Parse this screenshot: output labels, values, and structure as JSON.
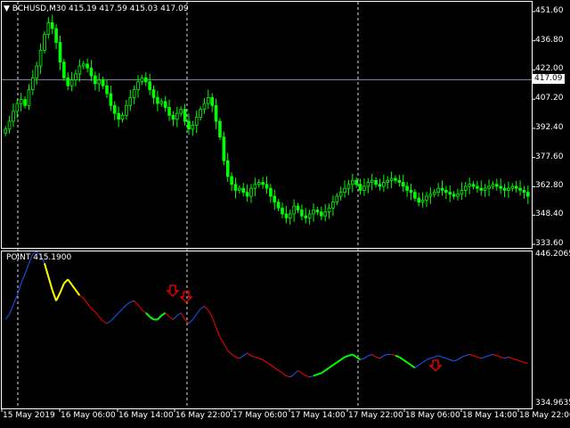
{
  "header": {
    "symbol_line": "BCHUSD,M30  415.19 417.59 415.03 417.09",
    "indicator_line": "POINT 415.1900"
  },
  "price_axis": {
    "labels": [
      "451.60",
      "436.80",
      "422.00",
      "407.20",
      "392.40",
      "377.60",
      "362.80",
      "348.40",
      "333.60"
    ],
    "current_price": "417.09"
  },
  "indicator_axis": {
    "top": "446.2065",
    "bottom": "334.9635"
  },
  "time_axis": {
    "labels": [
      "15 May 2019",
      "16 May 06:00",
      "16 May 14:00",
      "16 May 22:00",
      "17 May 06:00",
      "17 May 14:00",
      "17 May 22:00",
      "18 May 06:00",
      "18 May 14:00",
      "18 May 22:00"
    ]
  },
  "colors": {
    "background": "#000000",
    "candle": "#00ff00",
    "grid": "#ffffff",
    "signal_arrow": "#ff0000",
    "indicator_down": "#ff0000",
    "indicator_up": "#2255ff",
    "indicator_accent": "#ffff00",
    "indicator_green": "#00ff00"
  },
  "chart_data": [
    {
      "type": "candlestick",
      "title": "BCHUSD,M30",
      "ylim": [
        333.6,
        451.6
      ],
      "yticks": [
        451.6,
        436.8,
        422.0,
        407.2,
        392.4,
        377.6,
        362.8,
        348.4,
        333.6
      ],
      "current_price": 417.09,
      "x_ticks": [
        "15 May 2019",
        "16 May 06:00",
        "16 May 14:00",
        "16 May 22:00",
        "17 May 06:00",
        "17 May 14:00",
        "17 May 22:00",
        "18 May 06:00",
        "18 May 14:00",
        "18 May 22:00"
      ],
      "close": [
        392,
        396,
        401,
        405,
        407,
        404,
        412,
        418,
        424,
        432,
        440,
        446,
        443,
        436,
        426,
        418,
        414,
        417,
        420,
        424,
        425,
        423,
        419,
        415,
        417,
        414,
        410,
        404,
        400,
        397,
        399,
        404,
        408,
        412,
        416,
        418,
        416,
        412,
        408,
        405,
        406,
        403,
        399,
        397,
        400,
        402,
        396,
        392,
        394,
        398,
        402,
        405,
        408,
        404,
        396,
        388,
        376,
        368,
        364,
        361,
        362,
        360,
        358,
        362,
        364,
        365,
        364,
        362,
        358,
        355,
        352,
        349,
        347,
        349,
        353,
        351,
        348,
        347,
        349,
        351,
        350,
        348,
        350,
        352,
        355,
        358,
        360,
        362,
        364,
        366,
        364,
        361,
        363,
        365,
        366,
        364,
        363,
        365,
        366,
        367,
        366,
        365,
        363,
        361,
        360,
        357,
        355,
        356,
        358,
        359,
        360,
        362,
        361,
        360,
        359,
        358,
        359,
        361,
        363,
        364,
        363,
        362,
        361,
        362,
        363,
        364,
        363,
        362,
        361,
        362,
        363,
        362,
        361,
        360,
        358
      ]
    },
    {
      "type": "line",
      "title": "POINT",
      "ylim": [
        334.9635,
        446.2065
      ],
      "last_value": 415.19,
      "series": [
        {
          "values": [
            398,
            402,
            409,
            416,
            425,
            432,
            440,
            447,
            449,
            446,
            440,
            430,
            420,
            412,
            418,
            425,
            428,
            424,
            420,
            416,
            414,
            410,
            406,
            404,
            400,
            397,
            395,
            397,
            400,
            403,
            406,
            409,
            411,
            412,
            409,
            405,
            403,
            400,
            398,
            398,
            401,
            403,
            400,
            398,
            401,
            403,
            398,
            395,
            398,
            402,
            406,
            408,
            405,
            400,
            392,
            385,
            380,
            375,
            372,
            370,
            369,
            371,
            373,
            371,
            370,
            369,
            368,
            366,
            364,
            362,
            360,
            358,
            356,
            355,
            357,
            360,
            358,
            356,
            355,
            356,
            357,
            358,
            360,
            362,
            364,
            366,
            368,
            370,
            371,
            372,
            370,
            368,
            369,
            371,
            372,
            370,
            369,
            371,
            372,
            372,
            371,
            370,
            368,
            366,
            364,
            362,
            364,
            366,
            368,
            369,
            370,
            371,
            370,
            369,
            368,
            367,
            368,
            370,
            371,
            372,
            371,
            370,
            369,
            370,
            371,
            372,
            371,
            370,
            369,
            370,
            369,
            368,
            367,
            366,
            365
          ]
        }
      ]
    }
  ]
}
